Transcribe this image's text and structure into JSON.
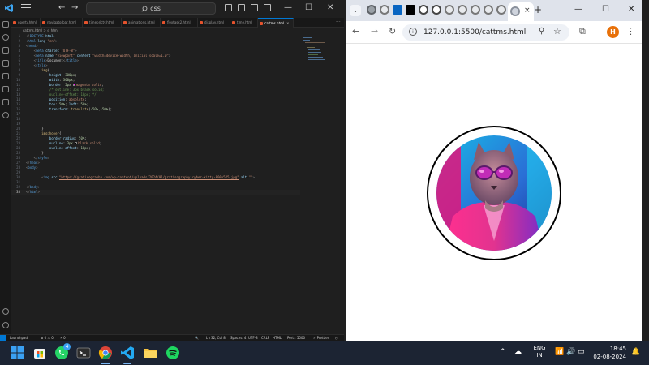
{
  "vscode": {
    "search_text": "css",
    "tabs": [
      {
        "label": "operty.html",
        "active": false
      },
      {
        "label": "navigatorbar.html",
        "active": false
      },
      {
        "label": "timeprjcty.html",
        "active": false
      },
      {
        "label": "animations.html",
        "active": false
      },
      {
        "label": "flextask2.html",
        "active": false
      },
      {
        "label": "display.html",
        "active": false
      },
      {
        "label": "time.html",
        "active": false
      },
      {
        "label": "cattms.html",
        "active": true
      }
    ],
    "active_tab_close": "×",
    "breadcrumb": "cattms.html > ⊙ html",
    "status": {
      "launchpad": "Launchpad",
      "problems": "⊗ 0 ⚠ 0",
      "ports": "⚡ 0",
      "position": "Ln 32, Col 8",
      "spaces": "Spaces: 4",
      "encoding": "UTF-8",
      "eol": "CRLF",
      "language": "HTML",
      "port": "Port : 5500",
      "prettier": "✓ Prettier"
    }
  },
  "chrome": {
    "url": "127.0.0.1:5500/cattms.html",
    "profile_initial": "H",
    "close_tab": "×",
    "new_tab": "+"
  },
  "taskbar": {
    "lang_top": "ENG",
    "lang_bottom": "IN",
    "time": "18:45",
    "date": "02-08-2024",
    "whatsapp_badge": "4"
  },
  "colors": {
    "vs_bg": "#1f1f1f",
    "accent": "#0078d4",
    "taskbar": "#1c2433",
    "profile": "#e8710a"
  }
}
